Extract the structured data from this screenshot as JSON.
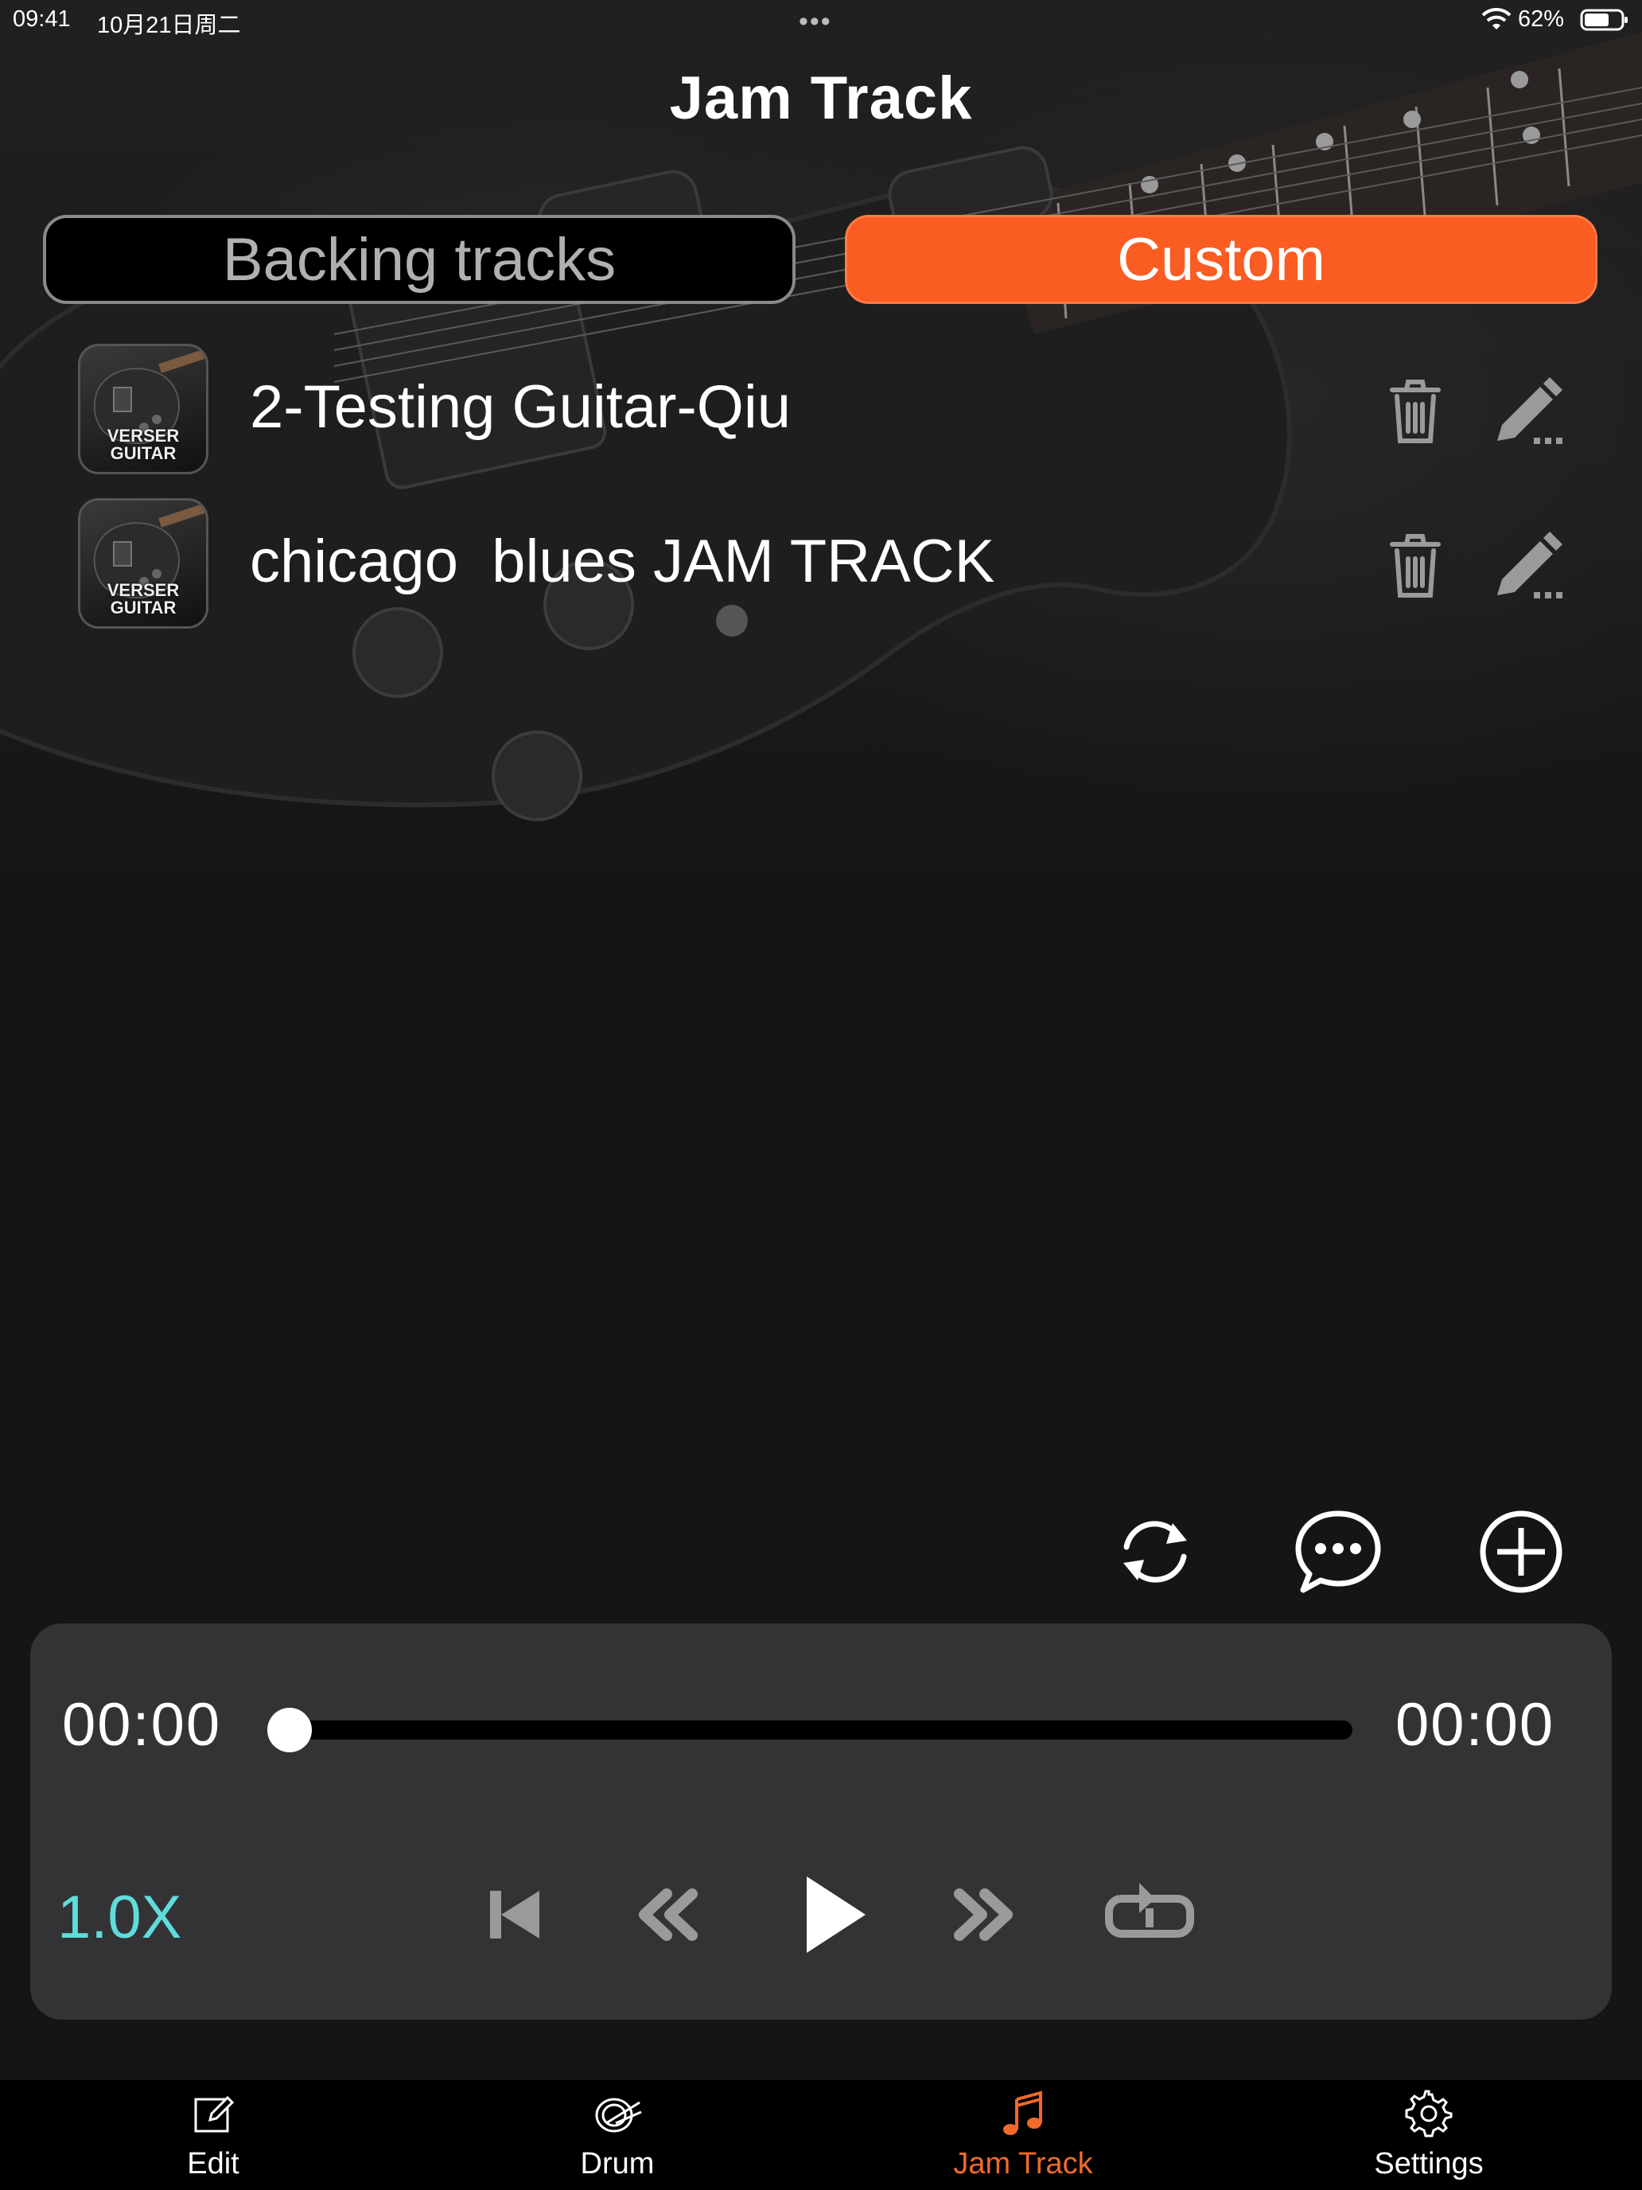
{
  "status_bar": {
    "time": "09:41",
    "date": "10月21日周二",
    "dots": "•••",
    "battery": "62%"
  },
  "nav": {
    "title": "Jam Track"
  },
  "segments": [
    {
      "label": "Backing tracks",
      "selected": false
    },
    {
      "label": "Custom",
      "selected": true
    }
  ],
  "tracks": [
    {
      "name": "2-Testing Guitar-Qiu",
      "thumb_brand_line1": "VERSER",
      "thumb_brand_line2": "GUITAR"
    },
    {
      "name": "chicago  blues JAM TRACK",
      "thumb_brand_line1": "VERSER",
      "thumb_brand_line2": "GUITAR"
    }
  ],
  "tools": [
    "refresh-icon",
    "chat-bubble-icon",
    "add-circle-icon"
  ],
  "player": {
    "time_current": "00:00",
    "time_total": "00:00",
    "progress": 0,
    "speed": "1.0X",
    "controls": [
      "skip-back-icon",
      "rewind-icon",
      "play-icon",
      "fast-forward-icon",
      "repeat-one-icon"
    ]
  },
  "tab_bar": {
    "items": [
      {
        "label": "Edit",
        "icon": "edit-square-icon"
      },
      {
        "label": "Drum",
        "icon": "drum-icon"
      },
      {
        "label": "Jam Track",
        "icon": "music-note-icon",
        "active": true
      },
      {
        "label": "Settings",
        "icon": "gear-icon"
      }
    ]
  },
  "colors": {
    "accent": "#fa5c22",
    "speed_text": "#5fdcdc",
    "active_tab": "#f06a2a",
    "player_bg": "#333335"
  }
}
